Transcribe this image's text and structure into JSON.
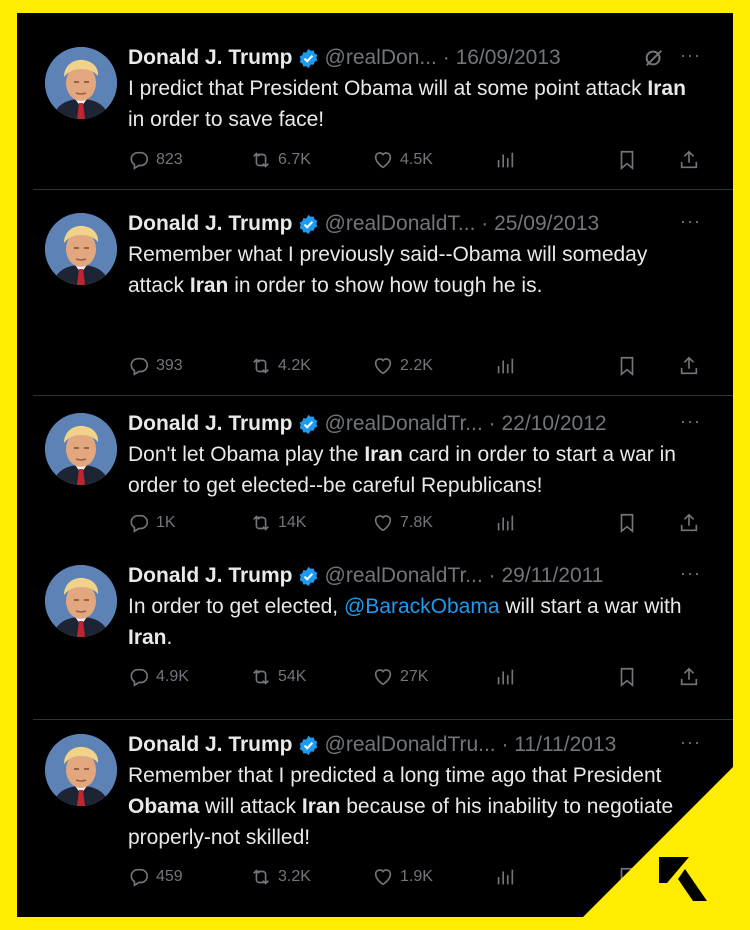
{
  "author": {
    "name": "Donald J. Trump"
  },
  "tweets": [
    {
      "handle": "@realDon...",
      "date": "16/09/2013",
      "segments": [
        {
          "t": "I predict that President Obama will at some point attack ",
          "s": "plain"
        },
        {
          "t": "Iran",
          "s": "bold"
        },
        {
          "t": " in order to save face!",
          "s": "plain"
        }
      ],
      "stats": {
        "replies": "823",
        "reposts": "6.7K",
        "likes": "4.5K"
      }
    },
    {
      "handle": "@realDonaldT...",
      "date": "25/09/2013",
      "segments": [
        {
          "t": "Remember what I previously said--Obama will someday attack ",
          "s": "plain"
        },
        {
          "t": "Iran",
          "s": "bold"
        },
        {
          "t": " in order to show how tough he is.",
          "s": "plain"
        }
      ],
      "stats": {
        "replies": "393",
        "reposts": "4.2K",
        "likes": "2.2K"
      }
    },
    {
      "handle": "@realDonaldTr...",
      "date": "22/10/2012",
      "segments": [
        {
          "t": "Don't let Obama play the ",
          "s": "plain"
        },
        {
          "t": "Iran",
          "s": "bold"
        },
        {
          "t": " card in order to start a war in order to get elected--be careful Republicans!",
          "s": "plain"
        }
      ],
      "stats": {
        "replies": "1K",
        "reposts": "14K",
        "likes": "7.8K"
      }
    },
    {
      "handle": "@realDonaldTr...",
      "date": "29/11/2011",
      "segments": [
        {
          "t": "In order to get elected, ",
          "s": "plain"
        },
        {
          "t": "@BarackObama",
          "s": "mention"
        },
        {
          "t": " will start a war with ",
          "s": "plain"
        },
        {
          "t": "Iran",
          "s": "bold"
        },
        {
          "t": ".",
          "s": "plain"
        }
      ],
      "stats": {
        "replies": "4.9K",
        "reposts": "54K",
        "likes": "27K"
      }
    },
    {
      "handle": "@realDonaldTru...",
      "date": "11/11/2013",
      "segments": [
        {
          "t": "Remember that I predicted a long time ago that President ",
          "s": "plain"
        },
        {
          "t": "Obama",
          "s": "bold"
        },
        {
          "t": " will attack ",
          "s": "plain"
        },
        {
          "t": "Iran",
          "s": "bold"
        },
        {
          "t": " because of his inability to negotiate properly-not skilled!",
          "s": "plain"
        }
      ],
      "stats": {
        "replies": "459",
        "reposts": "3.2K",
        "likes": "1.9K"
      }
    }
  ],
  "colors": {
    "frame": "#ffec00",
    "background": "#000000",
    "text": "#e7e9ea",
    "muted": "#71767b",
    "verified": "#1d9bf0",
    "mention": "#1d9bf0"
  },
  "icons": [
    "verified-badge-icon",
    "grok-icon",
    "more-dots-icon",
    "reply-icon",
    "repost-icon",
    "like-icon",
    "views-icon",
    "bookmark-icon",
    "share-icon"
  ]
}
